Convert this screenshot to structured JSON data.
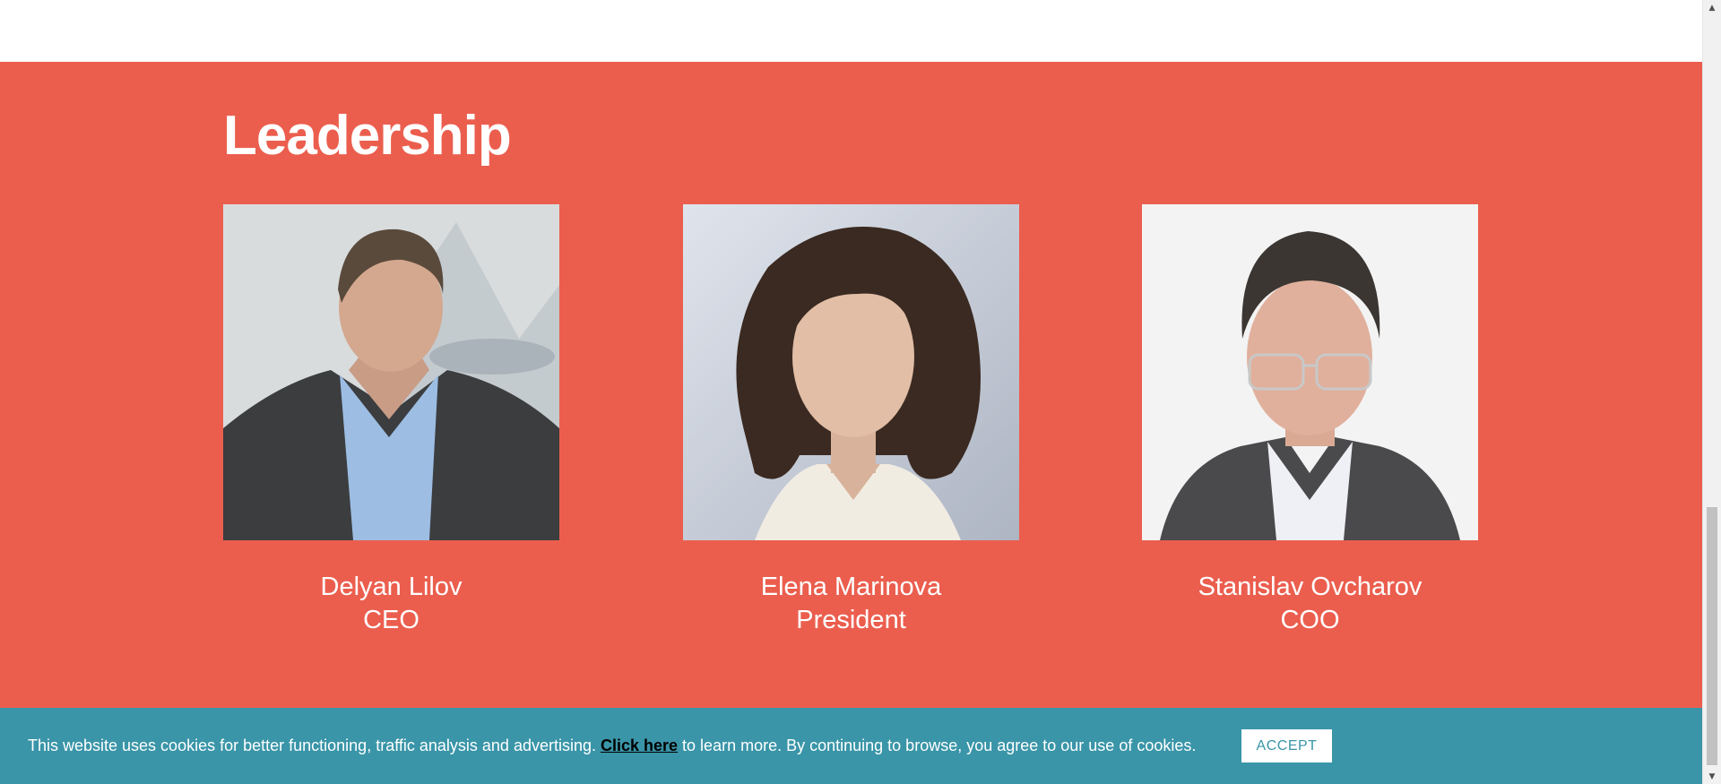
{
  "leadership": {
    "title": "Leadership",
    "people": [
      {
        "name": "Delyan Lilov",
        "role": "CEO"
      },
      {
        "name": "Elena Marinova",
        "role": "President"
      },
      {
        "name": "Stanislav Ovcharov",
        "role": "COO"
      }
    ]
  },
  "cookie_banner": {
    "text_before": "This website uses cookies for better functioning, traffic analysis and advertising. ",
    "link_label": "Click here",
    "text_after": " to learn more. By continuing to browse, you agree to our use of cookies.",
    "accept_label": "ACCEPT"
  },
  "colors": {
    "section_background": "#eb5e4e",
    "cookie_background": "#3a95a8",
    "text": "#ffffff"
  }
}
